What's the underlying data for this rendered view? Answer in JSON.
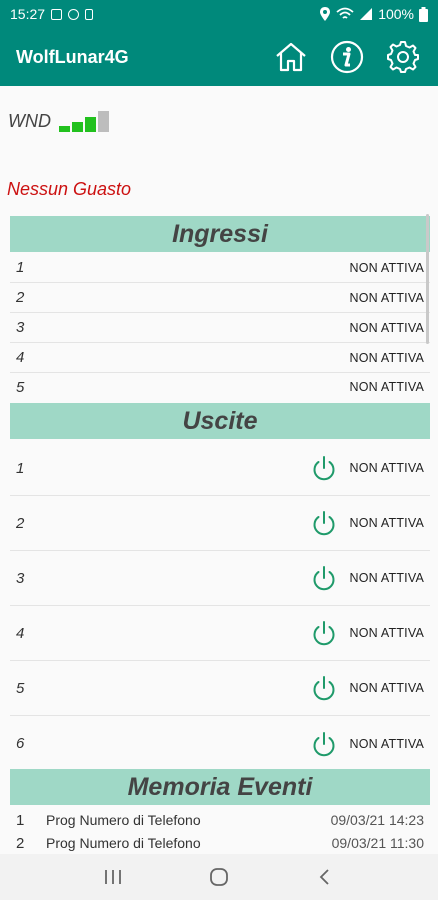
{
  "status_bar": {
    "time": "15:27",
    "battery": "100%"
  },
  "app_bar": {
    "title": "WolfLunar4G"
  },
  "signal": {
    "label": "WND",
    "level": 3,
    "max": 4
  },
  "fault_text": "Nessun Guasto",
  "ingressi": {
    "title": "Ingressi",
    "rows": [
      {
        "num": "1",
        "status": "NON ATTIVA"
      },
      {
        "num": "2",
        "status": "NON ATTIVA"
      },
      {
        "num": "3",
        "status": "NON ATTIVA"
      },
      {
        "num": "4",
        "status": "NON ATTIVA"
      },
      {
        "num": "5",
        "status": "NON ATTIVA"
      }
    ]
  },
  "uscite": {
    "title": "Uscite",
    "rows": [
      {
        "num": "1",
        "status": "NON ATTIVA"
      },
      {
        "num": "2",
        "status": "NON ATTIVA"
      },
      {
        "num": "3",
        "status": "NON ATTIVA"
      },
      {
        "num": "4",
        "status": "NON ATTIVA"
      },
      {
        "num": "5",
        "status": "NON ATTIVA"
      },
      {
        "num": "6",
        "status": "NON ATTIVA"
      }
    ]
  },
  "memoria": {
    "title": "Memoria Eventi",
    "rows": [
      {
        "num": "1",
        "text": "Prog Numero di Telefono",
        "datetime": "09/03/21 14:23"
      },
      {
        "num": "2",
        "text": "Prog Numero di Telefono",
        "datetime": "09/03/21 11:30"
      }
    ]
  },
  "colors": {
    "primary": "#00897b",
    "section": "#9fd8c6",
    "fault": "#cc1111",
    "signal_on": "#22c11e",
    "power_icon": "#1f9a6a"
  }
}
